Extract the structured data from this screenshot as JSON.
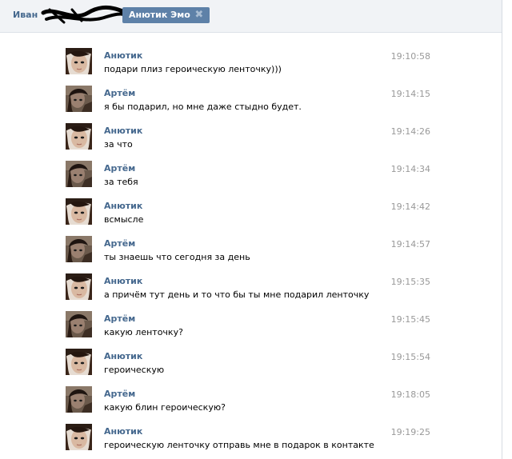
{
  "tabs": {
    "user_tab_label": "Иван",
    "active_tab_label": "Анютик Эмо",
    "close_icon": "close-icon"
  },
  "colors": {
    "link": "#45688e",
    "active_tab_bg": "#5e81a8",
    "time": "#999999"
  },
  "messages": [
    {
      "author": "Анютик",
      "text": "подари плиз героическую ленточку)))",
      "time": "19:10:58",
      "avatar": "anyutik"
    },
    {
      "author": "Артём",
      "text": "я бы подарил, но мне даже стыдно будет.",
      "time": "19:14:15",
      "avatar": "artyom"
    },
    {
      "author": "Анютик",
      "text": "за что",
      "time": "19:14:26",
      "avatar": "anyutik"
    },
    {
      "author": "Артём",
      "text": "за тебя",
      "time": "19:14:34",
      "avatar": "artyom"
    },
    {
      "author": "Анютик",
      "text": "всмысле",
      "time": "19:14:42",
      "avatar": "anyutik"
    },
    {
      "author": "Артём",
      "text": "ты знаешь что сегодня за день",
      "time": "19:14:57",
      "avatar": "artyom"
    },
    {
      "author": "Анютик",
      "text": "а причём тут день и то что бы ты мне подарил ленточку",
      "time": "19:15:35",
      "avatar": "anyutik"
    },
    {
      "author": "Артём",
      "text": "какую ленточку?",
      "time": "19:15:45",
      "avatar": "artyom"
    },
    {
      "author": "Анютик",
      "text": "героическую",
      "time": "19:15:54",
      "avatar": "anyutik"
    },
    {
      "author": "Артём",
      "text": "какую блин героическую?",
      "time": "19:18:05",
      "avatar": "artyom"
    },
    {
      "author": "Анютик",
      "text": "героическую ленточку отправь мне в подарок в контакте",
      "time": "19:19:25",
      "avatar": "anyutik"
    }
  ]
}
